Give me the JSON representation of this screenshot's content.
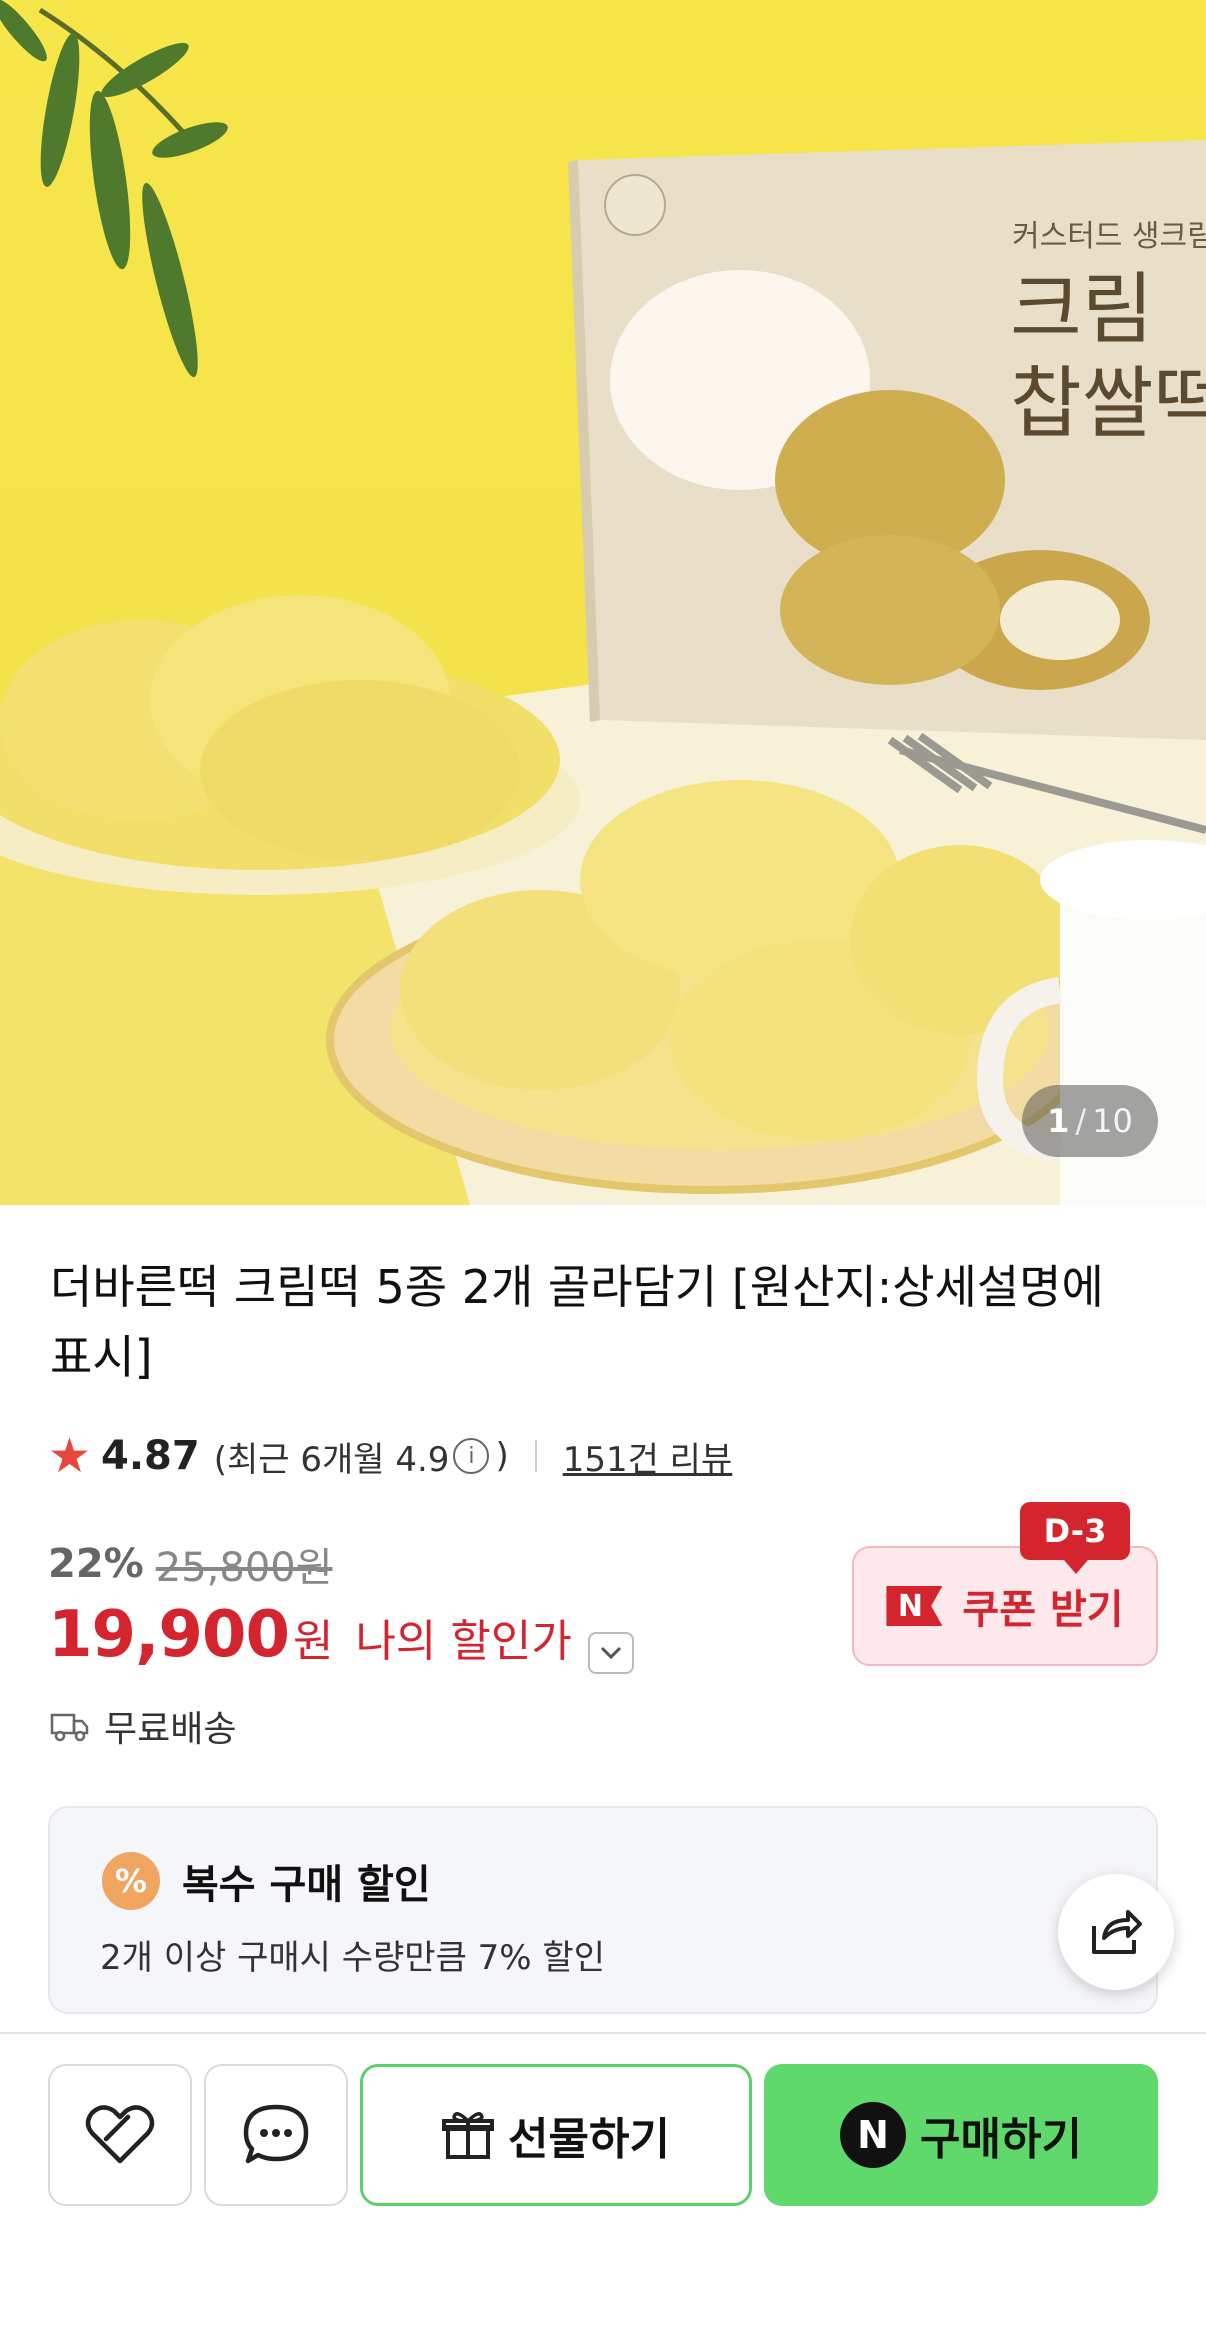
{
  "hero": {
    "image_label": "",
    "counter_current": "1",
    "counter_separator": "/",
    "counter_total": "10"
  },
  "product": {
    "title": "더바른떡 크림떡 5종 2개 골라담기 [원산지:상세설명에 표시]",
    "rating": "4.87",
    "recent_open": "(최근 6개월 4.9",
    "recent_close": ")",
    "reviews": "151건 리뷰",
    "discount_percent": "22%",
    "original_price": "25,800원",
    "price": "19,900",
    "price_unit": "원",
    "my_discount_label": "나의 할인가",
    "shipping": "무료배송"
  },
  "coupon": {
    "badge": "D-3",
    "logo": "N",
    "label": "쿠폰 받기"
  },
  "multi_buy": {
    "badge": "%",
    "title": "복수 구매 할인",
    "description": "2개 이상 구매시 수량만큼 7% 할인"
  },
  "actions": {
    "gift_label": "선물하기",
    "buy_logo": "N",
    "buy_label": "구매하기"
  },
  "colors": {
    "accent_red": "#d4252f",
    "buy_green": "#5fd86c",
    "gift_border": "#5cd16a",
    "hero_yellow": "#f4e24a"
  },
  "icons": [
    "star-icon",
    "info-icon",
    "chevron-down-icon",
    "truck-icon",
    "share-icon",
    "heart-icon",
    "chat-bubble-icon",
    "gift-icon",
    "naver-n-icon"
  ]
}
